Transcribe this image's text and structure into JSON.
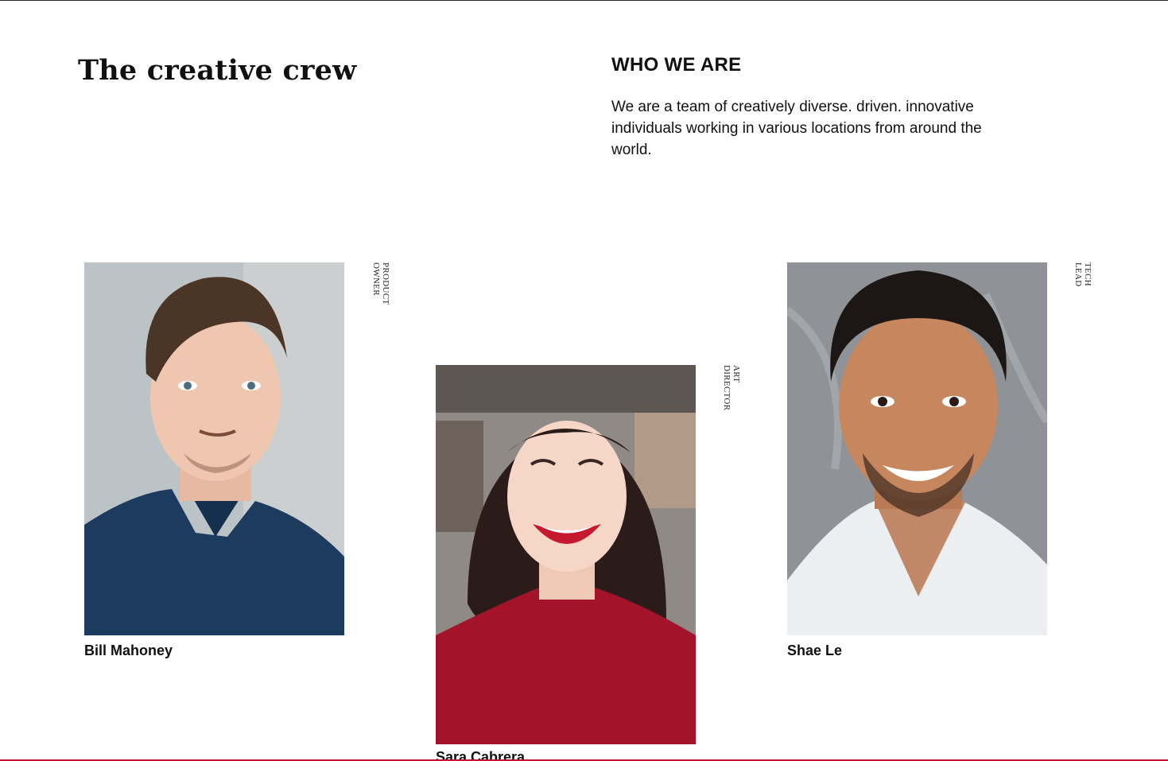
{
  "headline": "The creative crew",
  "about": {
    "heading": "WHO WE ARE",
    "text": "We are a team of creatively diverse. driven. innovative individuals working in various locations from around the world."
  },
  "members": [
    {
      "name": "Bill Mahoney",
      "role": "PRODUCT OWNER"
    },
    {
      "name": "Sara Cabrera",
      "role": "ART DIRECTOR"
    },
    {
      "name": "Shae Le",
      "role": "TECH LEAD"
    }
  ],
  "colors": {
    "accent_rule": "#c8102e",
    "text": "#111111"
  }
}
